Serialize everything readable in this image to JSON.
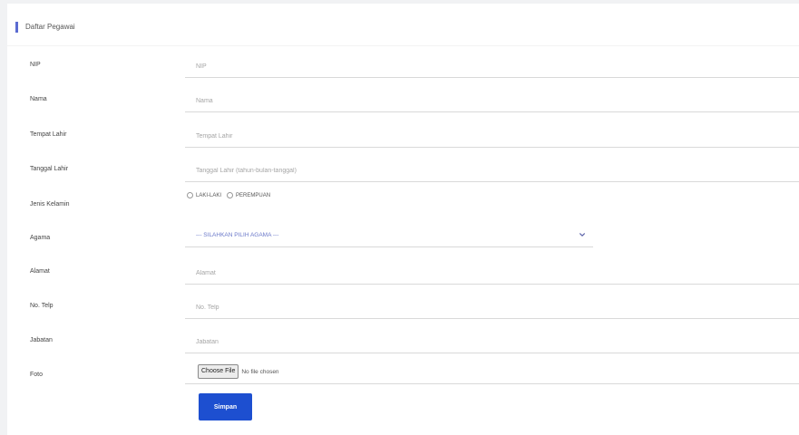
{
  "card": {
    "title": "Daftar Pegawai"
  },
  "form": {
    "nip": {
      "label": "NIP",
      "placeholder": "NIP"
    },
    "nama": {
      "label": "Nama",
      "placeholder": "Nama"
    },
    "tempat_lahir": {
      "label": "Tempat Lahir",
      "placeholder": "Tempat Lahir"
    },
    "tanggal_lahir": {
      "label": "Tanggal Lahir",
      "placeholder": "Tanggal Lahir (tahun-bulan-tanggal)"
    },
    "jenis_kelamin": {
      "label": "Jenis Kelamin",
      "options": [
        "LAKI-LAKI",
        "PEREMPUAN"
      ]
    },
    "agama": {
      "label": "Agama",
      "selected": "--- SILAHKAN PILIH AGAMA ---"
    },
    "alamat": {
      "label": "Alamat",
      "placeholder": "Alamat"
    },
    "no_telp": {
      "label": "No. Telp",
      "placeholder": "No. Telp"
    },
    "jabatan": {
      "label": "Jabatan",
      "placeholder": "Jabatan"
    },
    "foto": {
      "label": "Foto",
      "button": "Choose File",
      "status": "No file chosen"
    },
    "submit_label": "Simpan"
  },
  "colors": {
    "accent": "#5b6bd1",
    "button": "#1d4fd0",
    "select_text": "#6a78c9"
  }
}
